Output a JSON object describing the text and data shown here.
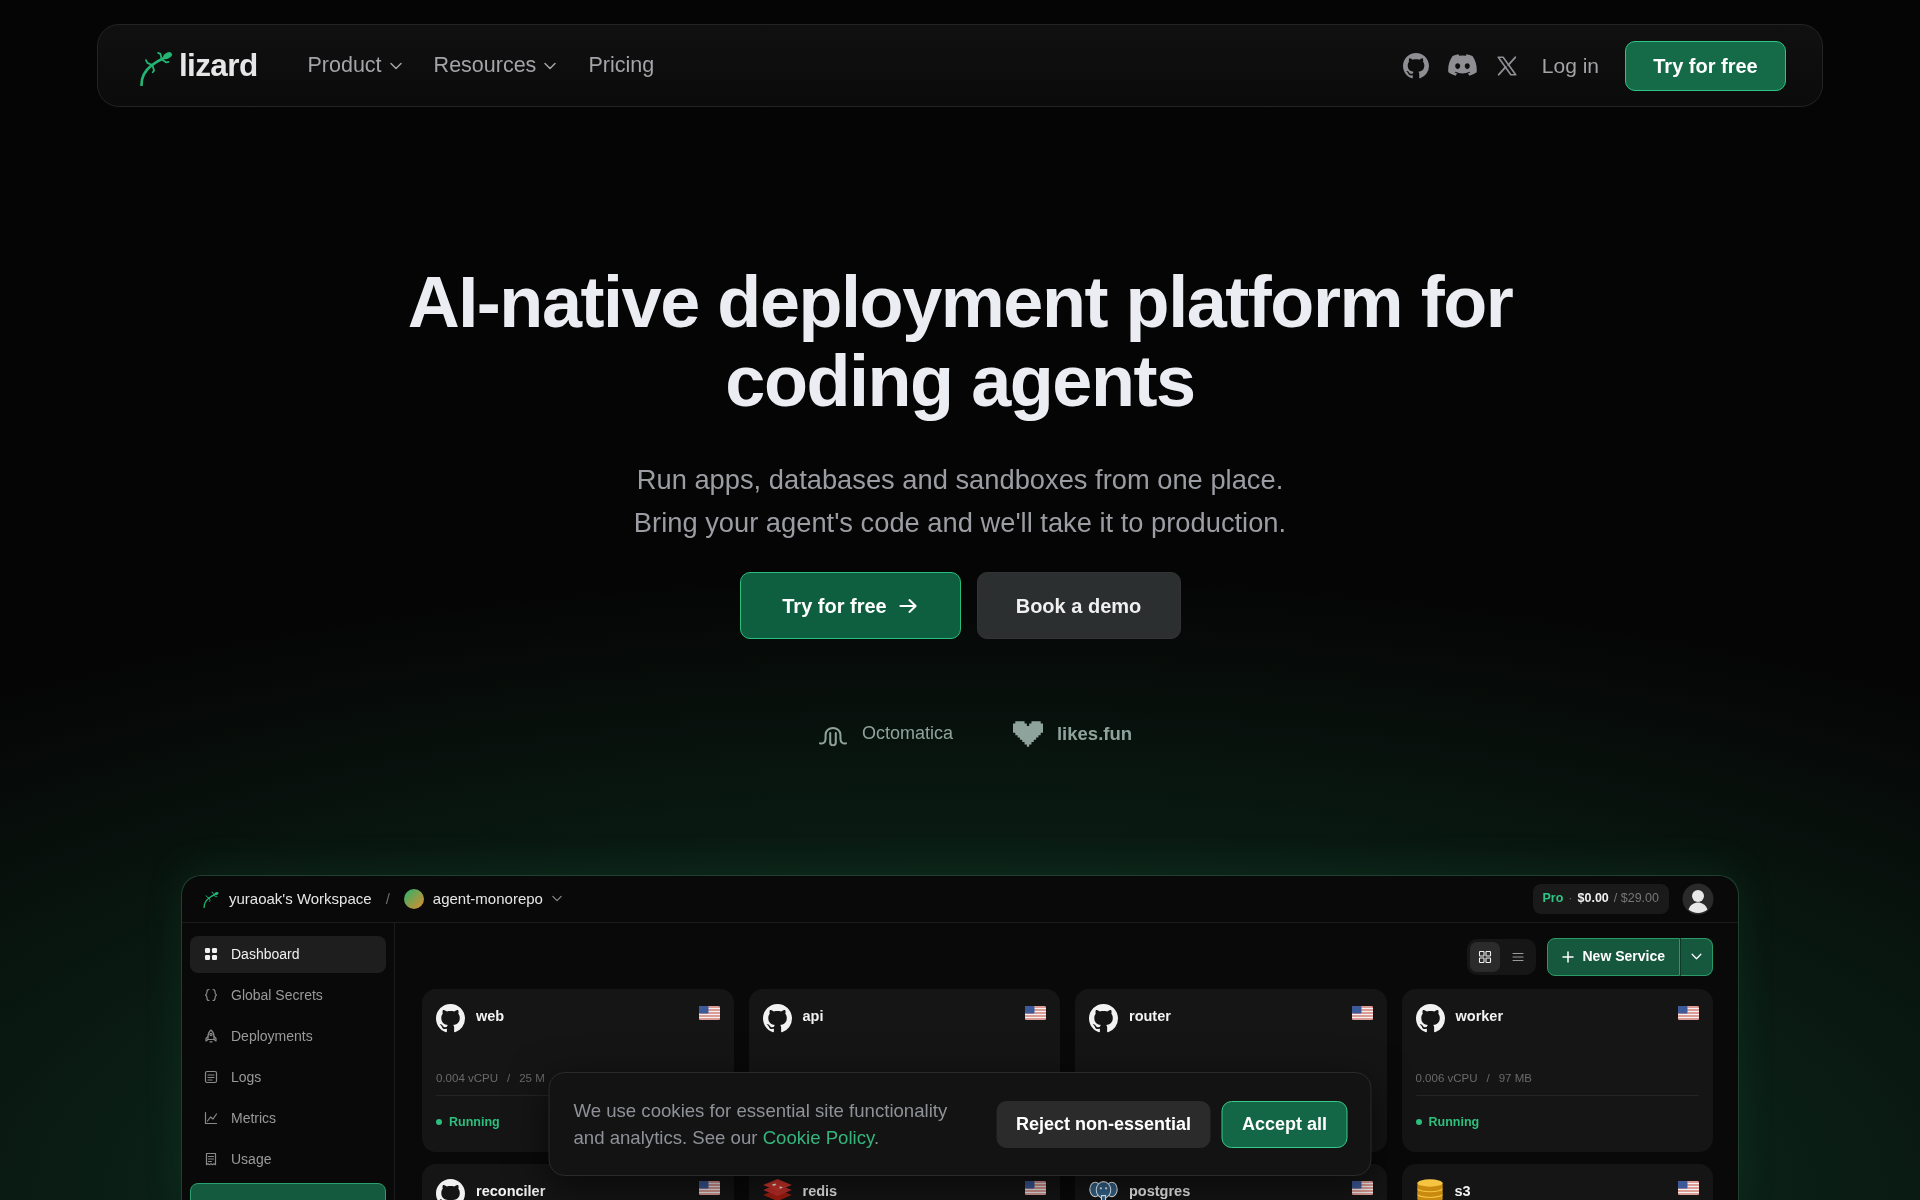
{
  "navbar": {
    "brand": "lizard",
    "menu": [
      {
        "label": "Product",
        "has_dropdown": true
      },
      {
        "label": "Resources",
        "has_dropdown": true
      },
      {
        "label": "Pricing",
        "has_dropdown": false
      }
    ],
    "login": "Log in",
    "cta": "Try for free"
  },
  "hero": {
    "title": "AI-native deployment platform for coding agents",
    "subtitle_lines": [
      "Run apps, databases and sandboxes from one place.",
      "Bring your agent's code and we'll take it to production."
    ],
    "buttons": [
      {
        "label": "Try for free",
        "kind": "primary"
      },
      {
        "label": "Book a demo",
        "kind": "secondary"
      }
    ],
    "logos": [
      {
        "name": "Octomatica",
        "kind": "octopus"
      },
      {
        "name": "likes.fun",
        "kind": "heart"
      }
    ]
  },
  "dashboard": {
    "workspace": "yuraoak's Workspace",
    "separator": "/",
    "project": "agent-monorepo",
    "plan": {
      "name": "Pro",
      "separator": "·",
      "spent": "$0.00",
      "limit": "/ $29.00"
    },
    "sidebar": [
      {
        "label": "Dashboard",
        "kind": "dashboard",
        "selected": true
      },
      {
        "label": "Global Secrets",
        "kind": "secrets",
        "selected": false
      },
      {
        "label": "Deployments",
        "kind": "deployments",
        "selected": false
      },
      {
        "label": "Logs",
        "kind": "logs",
        "selected": false
      },
      {
        "label": "Metrics",
        "kind": "metrics",
        "selected": false
      },
      {
        "label": "Usage",
        "kind": "usage",
        "selected": false
      }
    ],
    "view_toggle": [
      {
        "kind": "grid",
        "selected": true
      },
      {
        "kind": "list",
        "selected": false
      }
    ],
    "new_service": "New Service",
    "services": [
      {
        "name": "web",
        "kind": "repo",
        "cpu": "0.004 vCPU",
        "separator": "/",
        "memory": "25 M",
        "status": {
          "label": "Running",
          "kind": "running"
        }
      },
      {
        "name": "api",
        "kind": "repo"
      },
      {
        "name": "router",
        "kind": "repo"
      },
      {
        "name": "worker",
        "kind": "repo",
        "cpu": "0.006 vCPU",
        "separator": "/",
        "memory": "97 MB",
        "status": {
          "label": "Running",
          "kind": "running"
        }
      },
      {
        "name": "reconciler",
        "kind": "repo"
      },
      {
        "name": "redis",
        "kind": "cache"
      },
      {
        "name": "postgres",
        "kind": "database"
      },
      {
        "name": "s3",
        "kind": "storage"
      }
    ]
  },
  "cookie_banner": {
    "text": "We use cookies for essential site functionality and analytics. See our",
    "link": "Cookie Policy",
    "end": ".",
    "buttons": [
      {
        "label": "Reject non-essential",
        "kind": "secondary"
      },
      {
        "label": "Accept all",
        "kind": "primary"
      }
    ]
  }
}
